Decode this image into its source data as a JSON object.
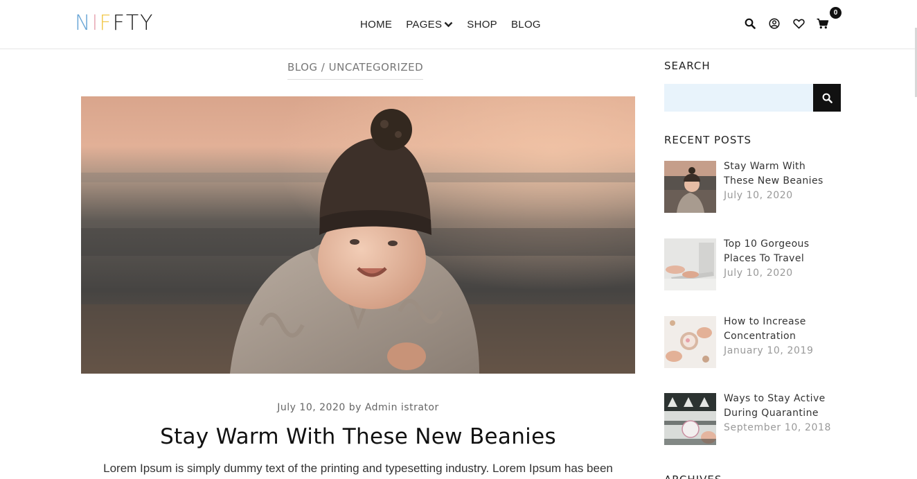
{
  "header": {
    "logo_letters": [
      {
        "char": "N",
        "color": "#6aa6d6"
      },
      {
        "char": "I",
        "color": "#e7a7b4"
      },
      {
        "char": "F",
        "color": "#f2c94c"
      },
      {
        "char": "F",
        "color": "#222222"
      },
      {
        "char": "T",
        "color": "#222222"
      },
      {
        "char": "Y",
        "color": "#222222"
      }
    ],
    "nav": [
      {
        "label": "HOME"
      },
      {
        "label": "PAGES",
        "has_dropdown": true
      },
      {
        "label": "SHOP"
      },
      {
        "label": "BLOG"
      }
    ],
    "icons": [
      "search-icon",
      "user-icon",
      "heart-icon",
      "cart-icon"
    ],
    "cart_count": "0"
  },
  "main": {
    "breadcrumb": "BLOG / UNCATEGORIZED",
    "meta": "July 10, 2020 by Admin istrator",
    "title": "Stay Warm With These New Beanies",
    "excerpt": "Lorem Ipsum is simply dummy text of the printing and typesetting industry. Lorem Ipsum has been"
  },
  "sidebar": {
    "search_title": "SEARCH",
    "search_placeholder": "",
    "recent_title": "RECENT POSTS",
    "recent_posts": [
      {
        "title": "Stay Warm With These New Beanies",
        "date": "July 10, 2020"
      },
      {
        "title": "Top 10 Gorgeous Places To Travel",
        "date": "July 10, 2020"
      },
      {
        "title": "How to Increase Concentration",
        "date": "January 10, 2019"
      },
      {
        "title": "Ways to Stay Active During Quarantine",
        "date": "September 10, 2018"
      }
    ],
    "archives_title": "ARCHIVES"
  },
  "colors": {
    "accent": "#111111",
    "search_bg": "#e8f3fb",
    "muted_text": "#999999"
  }
}
